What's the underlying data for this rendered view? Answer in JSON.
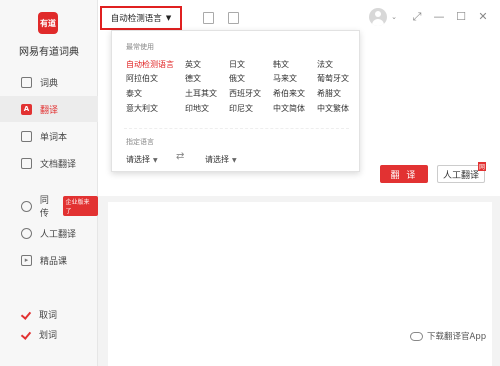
{
  "app": {
    "logo_text": "有道",
    "name": "网易有道词典"
  },
  "sidebar": {
    "items": [
      {
        "label": "词典"
      },
      {
        "label": "翻译"
      },
      {
        "label": "单词本"
      },
      {
        "label": "文档翻译"
      },
      {
        "label": "同传",
        "badge": "企业版来了"
      },
      {
        "label": "人工翻译"
      },
      {
        "label": "精品课"
      }
    ],
    "checks": [
      {
        "label": "取词"
      },
      {
        "label": "划词"
      }
    ]
  },
  "topbar": {
    "language_select": "自动检测语言"
  },
  "dropdown": {
    "common_title": "最常使用",
    "languages": [
      [
        "自动检测语言",
        "英文",
        "日文",
        "韩文",
        "法文"
      ],
      [
        "阿拉伯文",
        "德文",
        "俄文",
        "马来文",
        "葡萄牙文"
      ],
      [
        "泰文",
        "土耳其文",
        "西班牙文",
        "希伯来文",
        "希腊文"
      ],
      [
        "意大利文",
        "印地文",
        "印尼文",
        "中文简体",
        "中文繁体"
      ]
    ],
    "specify_title": "指定语言",
    "source_placeholder": "请选择",
    "target_placeholder": "请选择"
  },
  "actions": {
    "translate": "翻 译",
    "human": "人工翻译",
    "human_corner": "网"
  },
  "footer": {
    "download": "下载翻译官App"
  },
  "colors": {
    "accent": "#e23232"
  }
}
